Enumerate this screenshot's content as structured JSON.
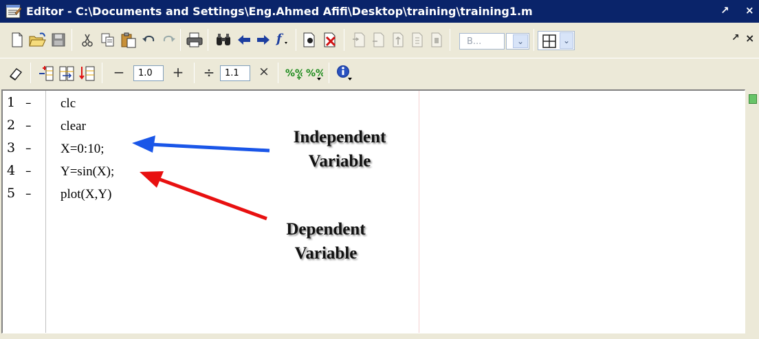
{
  "window": {
    "title": "Editor - C:\\Documents and Settings\\Eng.Ahmed Afifi\\Desktop\\training\\training1.m",
    "controls": [
      "↗",
      "×"
    ]
  },
  "toolbar": {
    "font_combo": "B...",
    "dock_controls": [
      "↗",
      "×"
    ]
  },
  "cell_toolbar": {
    "minus_label": "−",
    "plus_label": "+",
    "divide_label": "÷",
    "times_label": "×",
    "value1": "1.0",
    "value2": "1.1"
  },
  "editor": {
    "lines": [
      {
        "num": "1",
        "marker": "–",
        "code": "clc"
      },
      {
        "num": "2",
        "marker": "–",
        "code": "clear"
      },
      {
        "num": "3",
        "marker": "–",
        "code": "X=0:10;"
      },
      {
        "num": "4",
        "marker": "–",
        "code": "Y=sin(X);"
      },
      {
        "num": "5",
        "marker": "–",
        "code": "plot(X,Y)"
      }
    ],
    "annotations": {
      "independent_line1": "Independent",
      "independent_line2": "Variable",
      "dependent_line1": "Dependent",
      "dependent_line2": "Variable"
    }
  },
  "colors": {
    "title_bar": "#0a246a",
    "arrow_blue": "#1a56e8",
    "arrow_red": "#e81010"
  }
}
